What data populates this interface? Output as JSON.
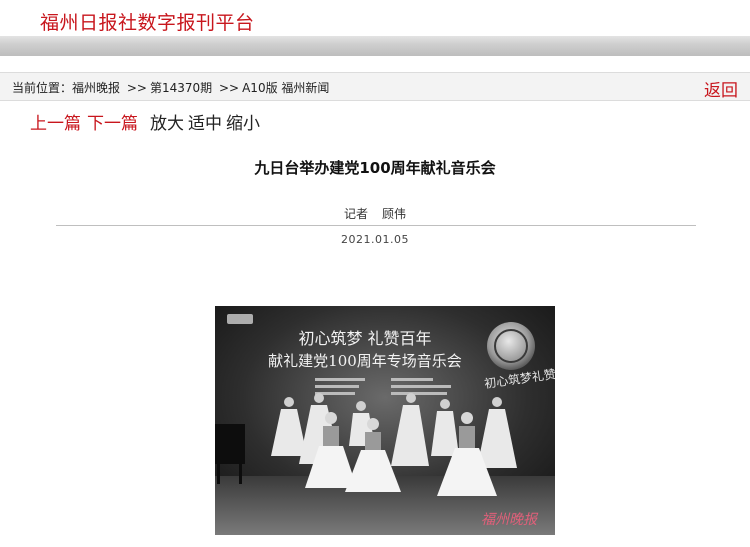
{
  "header": {
    "site_title": "福州日报社数字报刊平台"
  },
  "breadcrumb": {
    "prefix": "当前位置：",
    "items": [
      "福州晚报",
      "第14370期",
      "A10版 福州新闻"
    ],
    "separator": ">>",
    "back_label": "返回"
  },
  "article_nav": {
    "prev_label": "上一篇",
    "next_label": "下一篇",
    "zoom_in_label": "放大",
    "fit_label": "适中",
    "zoom_out_label": "缩小"
  },
  "article": {
    "title": "九日台举办建党100周年献礼音乐会",
    "reporter_label": "记者",
    "reporter_name": "顾伟",
    "date": "2021.01.05"
  },
  "photo": {
    "banner_line1": "初心筑梦  礼赞百年",
    "banner_line2": "献礼建党100周年专场音乐会",
    "side_text": "初心筑梦礼赞百年",
    "watermark": "福州晚报",
    "colors": {
      "watermark": "#e0607a",
      "background": "#1c1c1c"
    }
  },
  "colors": {
    "accent": "#c8161d",
    "text": "#222222"
  }
}
